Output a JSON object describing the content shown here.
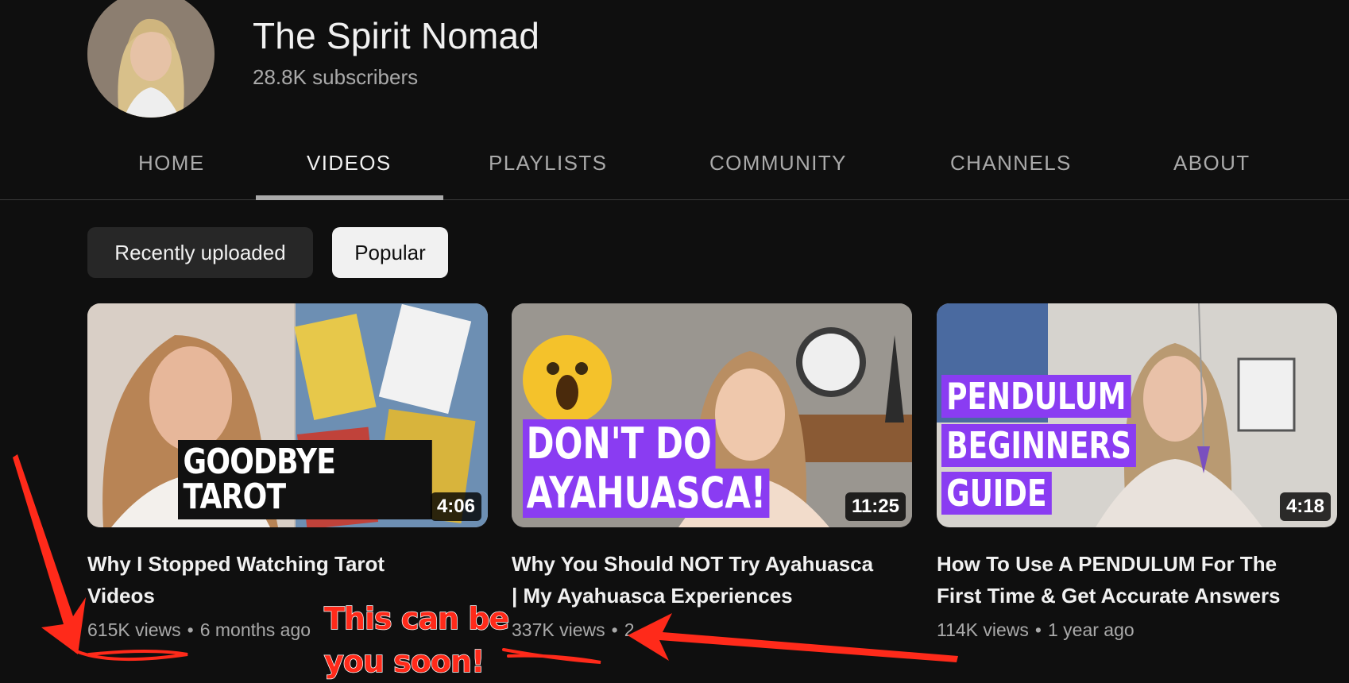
{
  "channel": {
    "name": "The Spirit Nomad",
    "subscribers": "28.8K subscribers"
  },
  "tabs": [
    {
      "label": "HOME",
      "active": false
    },
    {
      "label": "VIDEOS",
      "active": true
    },
    {
      "label": "PLAYLISTS",
      "active": false
    },
    {
      "label": "COMMUNITY",
      "active": false
    },
    {
      "label": "CHANNELS",
      "active": false
    },
    {
      "label": "ABOUT",
      "active": false
    }
  ],
  "filters": {
    "recent": "Recently uploaded",
    "popular": "Popular",
    "selected": "Popular"
  },
  "videos": [
    {
      "thumb_text": [
        "GOODBYE TAROT"
      ],
      "duration": "4:06",
      "title_line1": "Why I Stopped Watching Tarot",
      "title_line2": "Videos",
      "views": "615K views",
      "age": "6 months ago"
    },
    {
      "thumb_text": [
        "DON'T DO",
        "AYAHUASCA!"
      ],
      "duration": "11:25",
      "title_line1": "Why You Should NOT Try Ayahuasca",
      "title_line2": "| My Ayahuasca Experiences",
      "views": "337K views",
      "age": "2"
    },
    {
      "thumb_text": [
        "PENDULUM",
        "BEGINNERS",
        "GUIDE"
      ],
      "duration": "4:18",
      "title_line1": "How To Use A PENDULUM For The",
      "title_line2": "First Time & Get Accurate Answers",
      "views": "114K views",
      "age": "1 year ago"
    }
  ],
  "annotation": {
    "line1": "This can be",
    "line2": "you soon!",
    "color": "#ff2a1a"
  },
  "colors": {
    "background": "#0f0f0f",
    "accent_purple": "#8a3cf2",
    "secondary_text": "#aaaaaa"
  }
}
